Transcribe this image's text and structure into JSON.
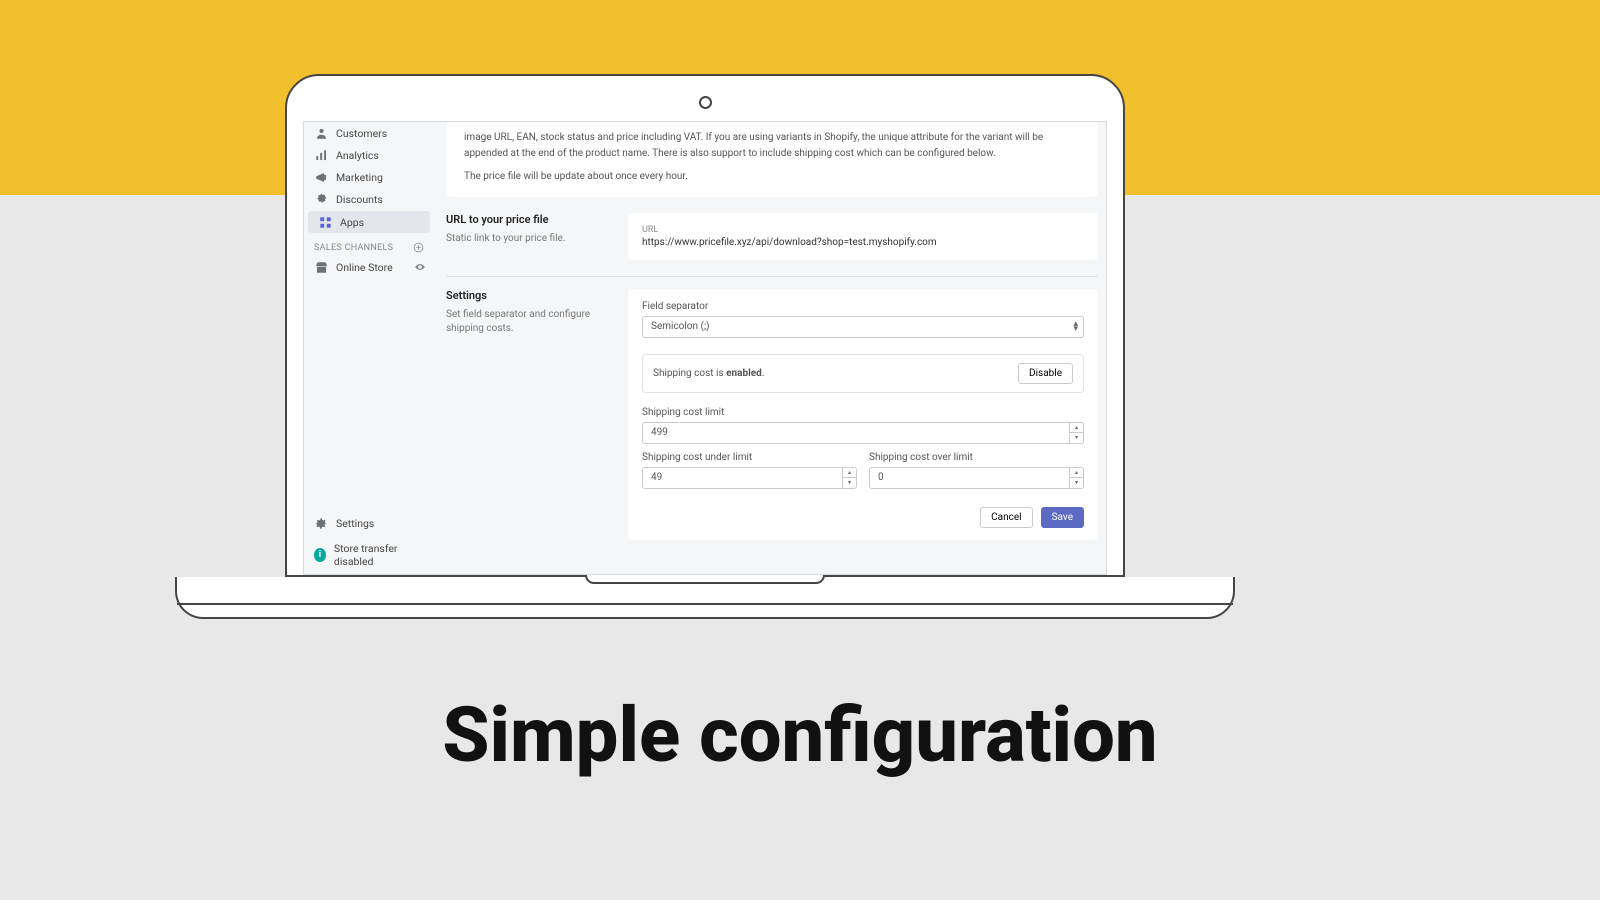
{
  "caption": "Simple configuration",
  "sidebar": {
    "items": [
      {
        "label": "Customers"
      },
      {
        "label": "Analytics"
      },
      {
        "label": "Marketing"
      },
      {
        "label": "Discounts"
      },
      {
        "label": "Apps"
      }
    ],
    "channels_header": "SALES CHANNELS",
    "channels": [
      {
        "label": "Online Store"
      }
    ],
    "settings_label": "Settings",
    "transfer_label": "Store transfer disabled"
  },
  "desc": {
    "p1": "image URL, EAN, stock status and price including VAT. If you are using variants in Shopify, the unique attribute for the variant will be appended at the end of the product name. There is also support to include shipping cost which can be configured below.",
    "p2": "The price file will be update about once every hour."
  },
  "url_section": {
    "title": "URL to your price file",
    "sub": "Static link to your price file.",
    "url_label": "URL",
    "url_value": "https://www.pricefile.xyz/api/download?shop=test.myshopify.com"
  },
  "settings_section": {
    "title": "Settings",
    "sub": "Set field separator and configure shipping costs.",
    "field_sep_label": "Field separator",
    "field_sep_value": "Semicolon (;)",
    "ship_text_a": "Shipping cost is ",
    "ship_text_b": "enabled",
    "ship_text_c": ".",
    "disable_btn": "Disable",
    "limit_label": "Shipping cost limit",
    "limit_value": "499",
    "under_label": "Shipping cost under limit",
    "under_value": "49",
    "over_label": "Shipping cost over limit",
    "over_value": "0",
    "cancel": "Cancel",
    "save": "Save"
  }
}
